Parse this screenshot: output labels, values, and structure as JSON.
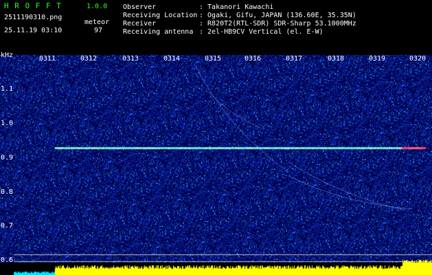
{
  "header": {
    "app_title": "H R O F F T",
    "app_version": "1.0.0",
    "filename": "2511190310.png",
    "datetime": "25.11.19 03:10",
    "meteor_label": "meteor",
    "meteor_count": "97",
    "info": [
      {
        "key": "Observer",
        "value": ": Takanori Kawachi"
      },
      {
        "key": "Receiving Location",
        "value": ": Ogaki, Gifu, JAPAN (136.60E, 35.35N)"
      },
      {
        "key": "Receiver",
        "value": ": R820T2(RTL-SDR) SDR-Sharp 53.1000MHz"
      },
      {
        "key": "Receiving antenna",
        "value": ": 2el-HB9CV Vertical (el. E-W)"
      }
    ]
  },
  "spectrogram": {
    "y_unit": "kHz",
    "y_ticks": [
      "1.1",
      "1.0",
      "0.9",
      "0.8",
      "0.7",
      "0.6"
    ],
    "x_ticks": [
      "0311",
      "0312",
      "0313",
      "0314",
      "0315",
      "0316",
      "0317",
      "0318",
      "0319",
      "0320"
    ]
  },
  "colors": {
    "background": "#000000",
    "noise_base": "#101c8c",
    "carrier": "#20ff60",
    "header_green": "#28ff28",
    "level_yellow": "#ffff00",
    "level_cyan": "#00ffff"
  }
}
